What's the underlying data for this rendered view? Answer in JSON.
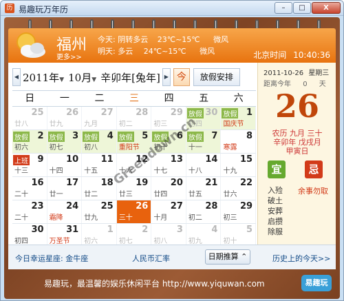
{
  "window": {
    "title": "易趣玩万年历",
    "min": "–",
    "max": "□",
    "close": "X"
  },
  "weather": {
    "city": "福州",
    "more": "更多>>",
    "today": {
      "label": "今天:",
      "desc": "阴转多云",
      "temp": "23℃~15℃",
      "wind": "微风"
    },
    "tomorrow": {
      "label": "明天:",
      "desc": "多云",
      "temp": "24℃~15℃",
      "wind": "微风"
    },
    "beijing_label": "北京时间",
    "time": "10:40:36"
  },
  "nav": {
    "year": "2011年",
    "month": "10月",
    "ganzhi": "辛卯年[兔年]",
    "today_label": "今",
    "holiday_label": "放假安排"
  },
  "weekdays": [
    "日",
    "一",
    "二",
    "三",
    "四",
    "五",
    "六"
  ],
  "weeks": [
    [
      {
        "d": "25",
        "l": "廿八",
        "dim": true
      },
      {
        "d": "26",
        "l": "廿九",
        "dim": true
      },
      {
        "d": "27",
        "l": "九月",
        "dim": true
      },
      {
        "d": "28",
        "l": "初二",
        "dim": true
      },
      {
        "d": "29",
        "l": "初三",
        "dim": true
      },
      {
        "d": "30",
        "l": "初四",
        "dim": true,
        "tag": "放假"
      },
      {
        "d": "1",
        "l": "国庆节",
        "tag": "放假",
        "red": true
      }
    ],
    [
      {
        "d": "2",
        "l": "初六",
        "tag": "放假"
      },
      {
        "d": "3",
        "l": "初七",
        "tag": "放假"
      },
      {
        "d": "4",
        "l": "初八",
        "tag": "放假"
      },
      {
        "d": "5",
        "l": "重阳节",
        "tag": "放假",
        "red": true
      },
      {
        "d": "6",
        "l": "初十",
        "tag": "放假"
      },
      {
        "d": "7",
        "l": "十一",
        "tag": "放假"
      },
      {
        "d": "8",
        "l": "寒露",
        "red": true
      }
    ],
    [
      {
        "d": "9",
        "l": "十三",
        "tag": "上班"
      },
      {
        "d": "10",
        "l": "十四"
      },
      {
        "d": "11",
        "l": "十五"
      },
      {
        "d": "12",
        "l": "十六"
      },
      {
        "d": "13",
        "l": "十七"
      },
      {
        "d": "14",
        "l": "十八"
      },
      {
        "d": "15",
        "l": "十九"
      }
    ],
    [
      {
        "d": "16",
        "l": "二十"
      },
      {
        "d": "17",
        "l": "廿一"
      },
      {
        "d": "18",
        "l": "廿二"
      },
      {
        "d": "19",
        "l": "廿三"
      },
      {
        "d": "20",
        "l": "廿四"
      },
      {
        "d": "21",
        "l": "廿五"
      },
      {
        "d": "22",
        "l": "廿六"
      }
    ],
    [
      {
        "d": "23",
        "l": "二十"
      },
      {
        "d": "24",
        "l": "霜降",
        "red": true
      },
      {
        "d": "25",
        "l": "廿九"
      },
      {
        "d": "26",
        "l": "三十",
        "today": true
      },
      {
        "d": "27",
        "l": "十月"
      },
      {
        "d": "28",
        "l": "初二"
      },
      {
        "d": "29",
        "l": "初三"
      }
    ],
    [
      {
        "d": "30",
        "l": "初四"
      },
      {
        "d": "31",
        "l": "万圣节",
        "red": true
      },
      {
        "d": "1",
        "l": "初六",
        "dim": true
      },
      {
        "d": "2",
        "l": "初七",
        "dim": true
      },
      {
        "d": "3",
        "l": "初八",
        "dim": true
      },
      {
        "d": "4",
        "l": "初九",
        "dim": true
      },
      {
        "d": "5",
        "l": "初十",
        "dim": true
      }
    ]
  ],
  "side": {
    "date": "2011-10-26",
    "weekday": "星期三",
    "countdown_label": "距离今年",
    "countdown_value": "0",
    "countdown_unit": "天",
    "day": "26",
    "lunar1": "农历 九月 三十",
    "lunar2": "辛卯年 戊戌月",
    "lunar3": "甲寅日",
    "yi": "宜",
    "ji": "忌",
    "yi_items": [
      "入殓",
      "破土",
      "安葬",
      "启攒",
      "除服"
    ],
    "ji_items": [
      "余事勿取"
    ]
  },
  "bottom": {
    "constellation": "今日幸运星座: 金牛座",
    "rmb": "人民币汇率",
    "datecalc": "日期推算 ⌃",
    "history": "历史上的今天>>"
  },
  "footer": {
    "text": "易趣玩，最温馨的娱乐休闲平台   http://www.yiquwan.com",
    "logo": "易趣玩"
  },
  "watermark": "Greendown.cn"
}
